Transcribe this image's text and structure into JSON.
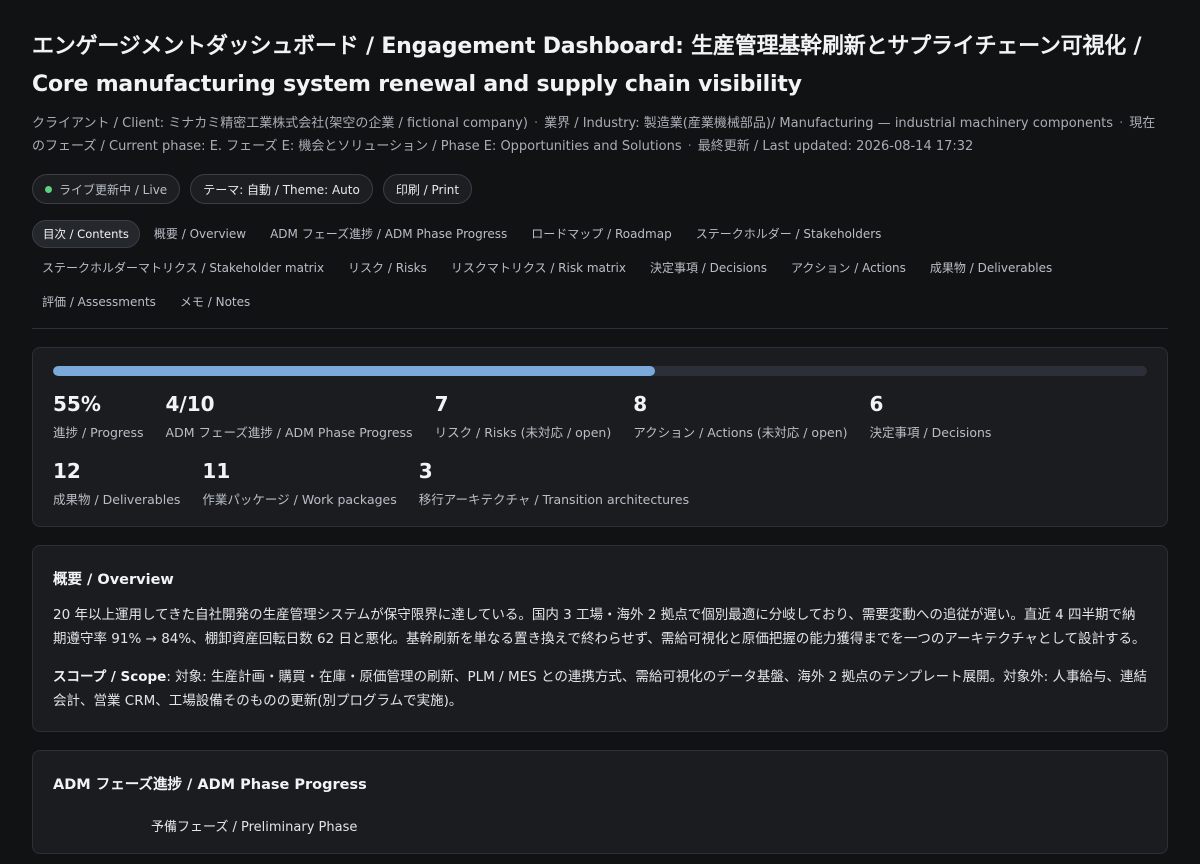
{
  "header": {
    "title": "エンゲージメントダッシュボード / Engagement Dashboard: 生産管理基幹刷新とサプライチェーン可視化 / Core manufacturing system renewal and supply chain visibility",
    "client": "クライアント / Client: ミナカミ精密工業株式会社(架空の企業 / fictional company)",
    "industry": "業界 / Industry: 製造業(産業機械部品)/ Manufacturing — industrial machinery components",
    "phase": "現在のフェーズ / Current phase: E. フェーズ E: 機会とソリューション / Phase E: Opportunities and Solutions",
    "updated": "最終更新 / Last updated: 2026-08-14 17:32",
    "separator": "·"
  },
  "actions": {
    "live": "ライブ更新中 / Live",
    "theme": "テーマ: 自動 / Theme: Auto",
    "print": "印刷 / Print"
  },
  "toc": [
    "目次 / Contents",
    "概要 / Overview",
    "ADM フェーズ進捗 / ADM Phase Progress",
    "ロードマップ / Roadmap",
    "ステークホルダー / Stakeholders",
    "ステークホルダーマトリクス / Stakeholder matrix",
    "リスク / Risks",
    "リスクマトリクス / Risk matrix",
    "決定事項 / Decisions",
    "アクション / Actions",
    "成果物 / Deliverables",
    "評価 / Assessments",
    "メモ / Notes"
  ],
  "summary": {
    "progress_fraction": 0.55,
    "stats": [
      {
        "value": "55%",
        "label": "進捗 / Progress"
      },
      {
        "value": "4/10",
        "label": "ADM フェーズ進捗 / ADM Phase Progress"
      },
      {
        "value": "7",
        "label": "リスク / Risks (未対応 / open)"
      },
      {
        "value": "8",
        "label": "アクション / Actions (未対応 / open)"
      },
      {
        "value": "6",
        "label": "決定事項 / Decisions"
      },
      {
        "value": "12",
        "label": "成果物 / Deliverables"
      },
      {
        "value": "11",
        "label": "作業パッケージ / Work packages"
      },
      {
        "value": "3",
        "label": "移行アーキテクチャ / Transition architectures"
      }
    ]
  },
  "overview": {
    "title": "概要 / Overview",
    "body": "20 年以上運用してきた自社開発の生産管理システムが保守限界に達している。国内 3 工場・海外 2 拠点で個別最適に分岐しており、需要変動への追従が遅い。直近 4 四半期で納期遵守率 91% → 84%、棚卸資産回転日数 62 日と悪化。基幹刷新を単なる置き換えで終わらせず、需給可視化と原価把握の能力獲得までを一つのアーキテクチャとして設計する。",
    "scope_label": "スコープ / Scope",
    "scope_text": ": 対象: 生産計画・購買・在庫・原価管理の刷新、PLM / MES との連携方式、需給可視化のデータ基盤、海外 2 拠点のテンプレート展開。対象外: 人事給与、連結会計、営業 CRM、工場設備そのものの更新(別プログラムで実施)。"
  },
  "adm": {
    "title": "ADM フェーズ進捗 / ADM Phase Progress",
    "first_phase": "予備フェーズ / Preliminary Phase"
  },
  "colors": {
    "accent": "#7aa9da",
    "live_dot": "#5fcf80",
    "background": "#111214",
    "card": "#1a1c20"
  }
}
